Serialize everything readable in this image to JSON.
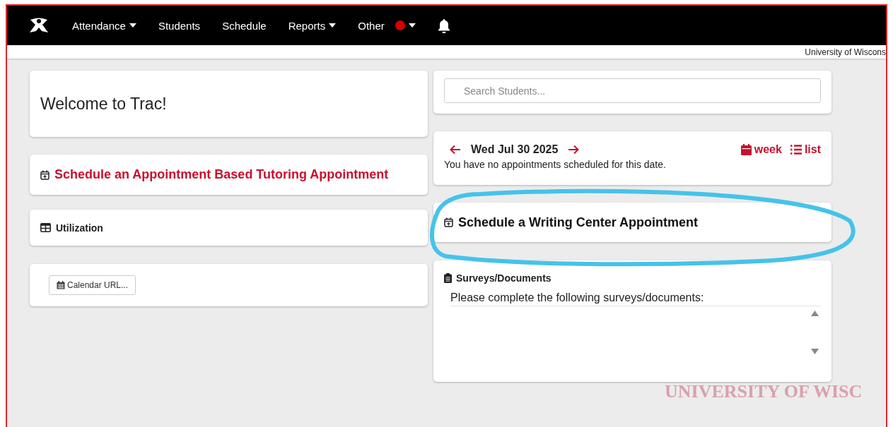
{
  "nav": {
    "items": [
      {
        "label": "Attendance",
        "dropdown": true,
        "alert": false
      },
      {
        "label": "Students",
        "dropdown": false,
        "alert": false
      },
      {
        "label": "Schedule",
        "dropdown": false,
        "alert": false
      },
      {
        "label": "Reports",
        "dropdown": true,
        "alert": false
      },
      {
        "label": "Other",
        "dropdown": true,
        "alert": true
      }
    ]
  },
  "institution": "University of Wiscons",
  "welcome": "Welcome to Trac!",
  "tutoring_link": "Schedule an Appointment Based Tutoring Appointment",
  "utilization": "Utilization",
  "calendar_button": "Calendar URL...",
  "search": {
    "placeholder": "Search Students..."
  },
  "date_card": {
    "date": "Wed Jul 30 2025",
    "message": "You have no appointments scheduled for this date.",
    "views": [
      {
        "label": "week",
        "kind": "week"
      },
      {
        "label": "list",
        "kind": "list"
      }
    ]
  },
  "writing_center": "Schedule a Writing Center Appointment",
  "surveys": {
    "title": "Surveys/Documents",
    "message": "Please complete the following surveys/documents:"
  },
  "background_text": "UNIVERSITY OF WISC"
}
